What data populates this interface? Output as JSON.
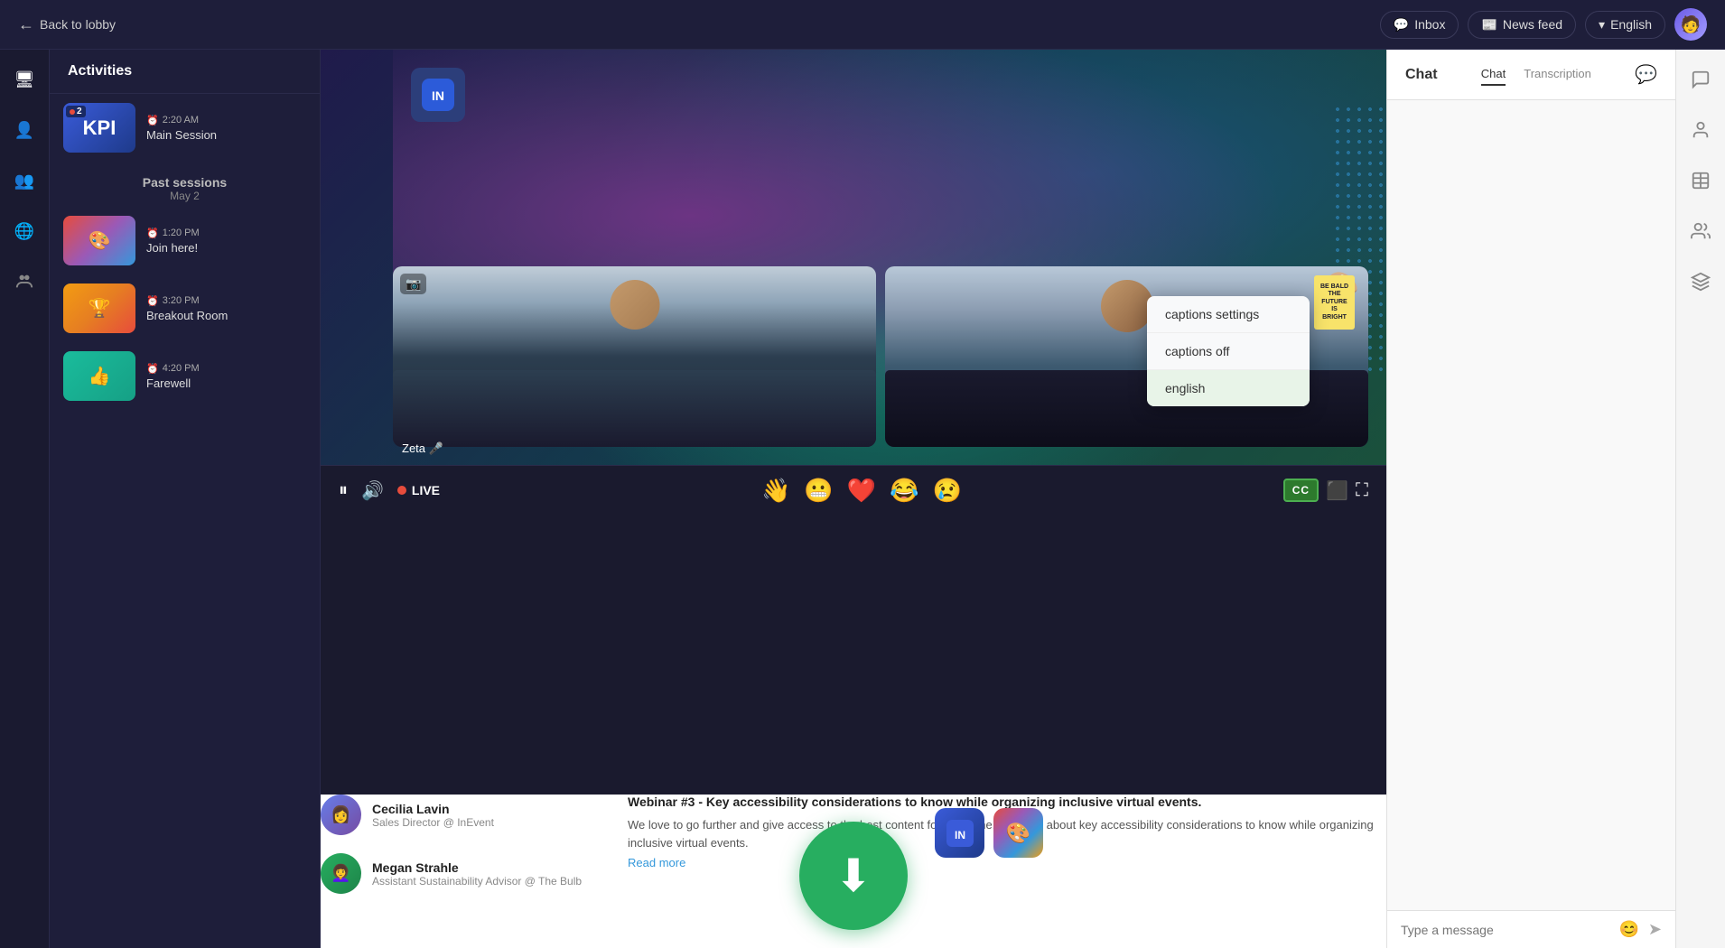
{
  "topNav": {
    "backLabel": "Back to lobby",
    "inboxLabel": "Inbox",
    "newsFeedLabel": "News feed",
    "languageLabel": "English",
    "avatarEmoji": "🧑‍💻"
  },
  "leftSidebar": {
    "icons": [
      {
        "name": "monitor-icon",
        "symbol": "🖥",
        "interactable": true
      },
      {
        "name": "user-icon",
        "symbol": "👤",
        "interactable": true
      },
      {
        "name": "people-icon",
        "symbol": "👥",
        "interactable": true
      },
      {
        "name": "globe-icon",
        "symbol": "🌐",
        "interactable": true
      },
      {
        "name": "group-icon",
        "symbol": "👥",
        "interactable": true
      }
    ]
  },
  "activitiesPanel": {
    "title": "Activities",
    "currentSession": {
      "time": "2:20 AM",
      "name": "Main Session",
      "thumbnail": "KPI"
    },
    "pastSessions": {
      "title": "Past sessions",
      "date": "May 2",
      "items": [
        {
          "time": "1:20 PM",
          "name": "Join here!",
          "emoji": "🎨"
        },
        {
          "time": "3:20 PM",
          "name": "Breakout Room",
          "emoji": "🏆"
        },
        {
          "time": "4:20 PM",
          "name": "Farewell",
          "emoji": "👍"
        }
      ]
    }
  },
  "videoPlayer": {
    "liveBadge": "LIVE",
    "speakerName": "Zeta 🎤",
    "captionsMenu": {
      "items": [
        {
          "label": "captions settings",
          "selected": false
        },
        {
          "label": "captions off",
          "selected": false
        },
        {
          "label": "english",
          "selected": true
        }
      ]
    },
    "reactions": [
      "👋",
      "😬",
      "❤️",
      "😂",
      "😢"
    ],
    "controls": {
      "ccLabel": "CC",
      "pauseSymbol": "⏸",
      "volumeSymbol": "🔊"
    }
  },
  "chatPanel": {
    "title": "Chat",
    "tabs": [
      {
        "label": "Chat",
        "active": true
      },
      {
        "label": "Transcription",
        "active": false
      }
    ],
    "inputPlaceholder": "Type a message"
  },
  "bottomInfo": {
    "speakers": [
      {
        "name": "Cecilia Lavin",
        "title": "Sales Director @ InEvent",
        "emoji": "👩"
      },
      {
        "name": "Megan Strahle",
        "title": "Assistant Sustainability Advisor @ The Bulb",
        "emoji": "👩‍🦱"
      }
    ],
    "webinar": {
      "title": "Webinar #3 - Key accessibility considerations to know while organizing inclusive virtual events.",
      "description": "We love to go further and give access to the best content for everyone!Let`s talk about key accessibility considerations to know while organizing inclusive virtual events.",
      "readMore": "Read more"
    }
  },
  "rightSidebar": {
    "icons": [
      {
        "name": "chat-bubble-icon",
        "symbol": "💬"
      },
      {
        "name": "user-profile-icon",
        "symbol": "👤"
      },
      {
        "name": "table-icon",
        "symbol": "▦"
      },
      {
        "name": "people-group-icon",
        "symbol": "👥"
      },
      {
        "name": "layers-icon",
        "symbol": "⧉"
      }
    ]
  },
  "appIcons": [
    {
      "name": "inevent-app-icon",
      "symbol": "IN"
    },
    {
      "name": "colorful-app-icon",
      "symbol": "🎨"
    }
  ],
  "downloadButton": {
    "arrowSymbol": "⬇"
  }
}
